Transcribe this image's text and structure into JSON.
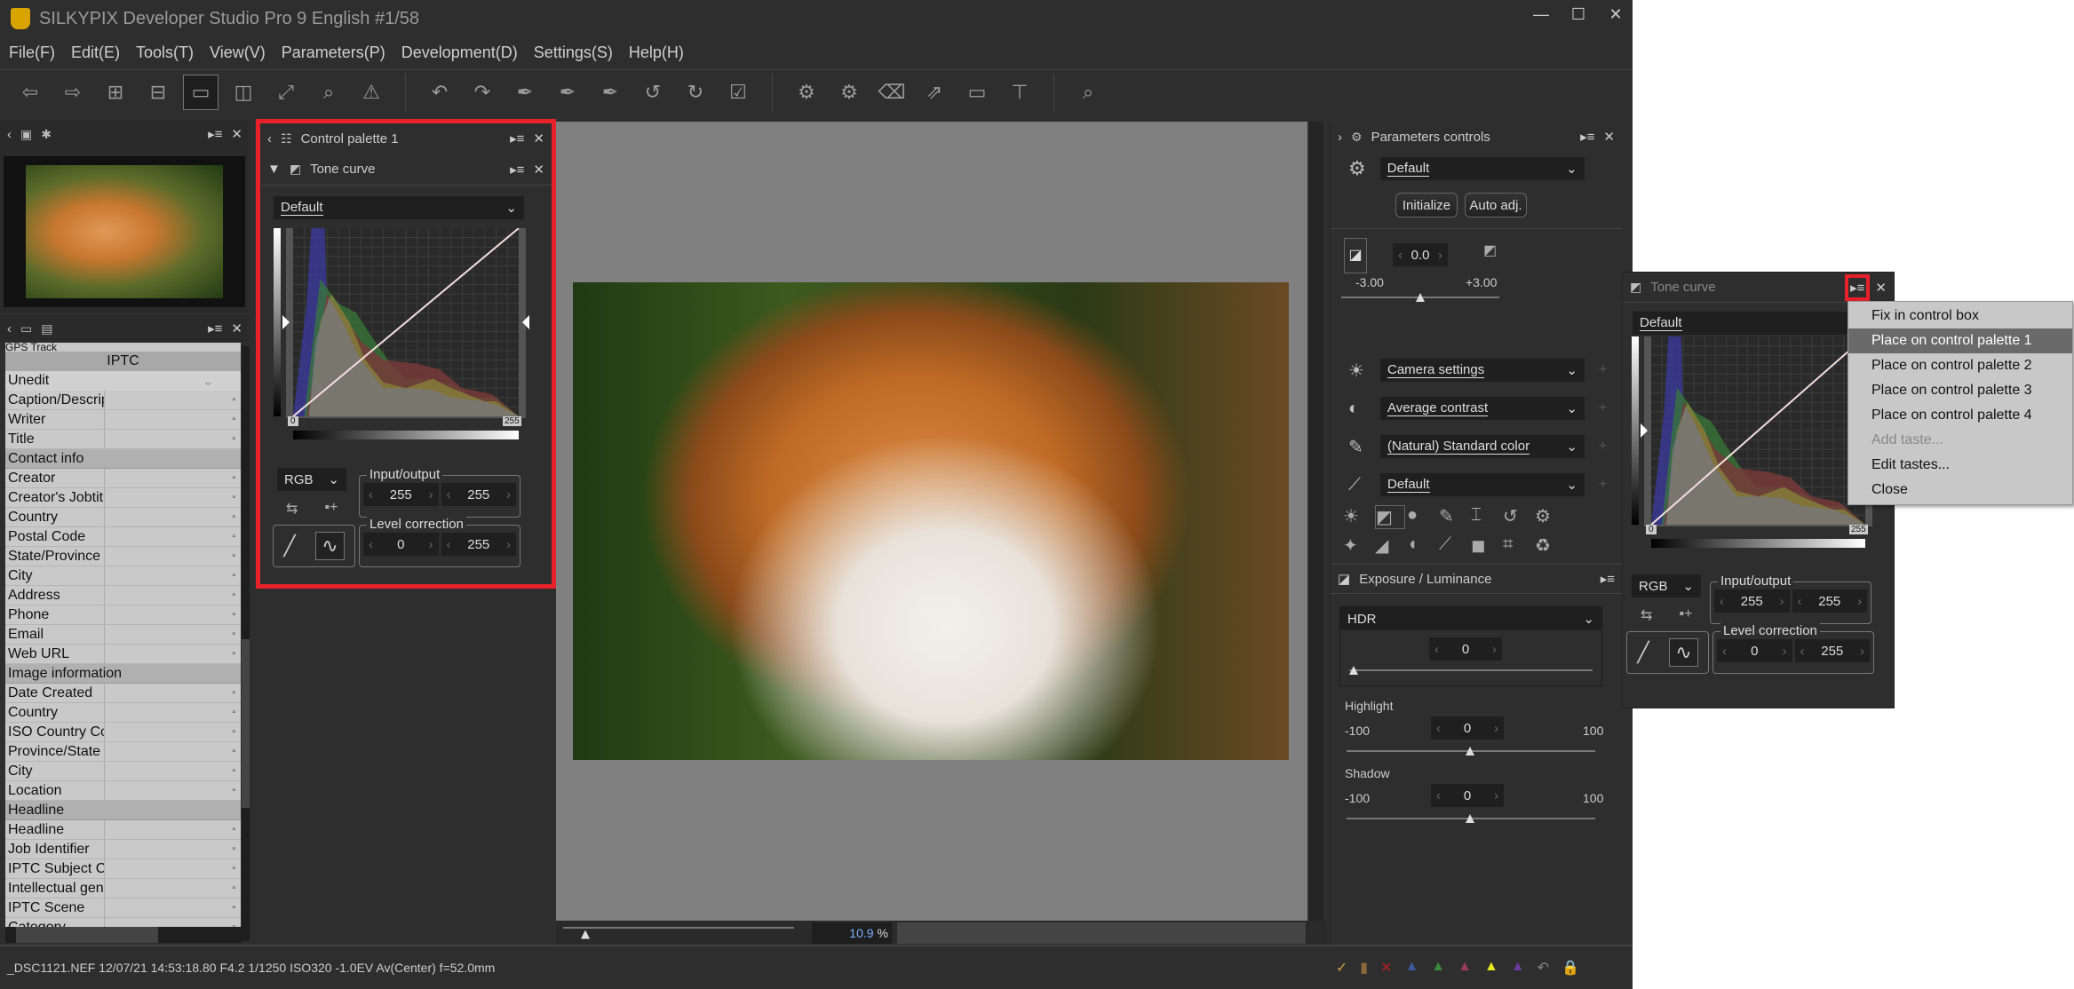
{
  "window": {
    "title": "SILKYPIX Developer Studio Pro 9 English   #1/58",
    "logo": "DS",
    "minimize": "—",
    "maximize": "☐",
    "close": "✕"
  },
  "menu": [
    "File(F)",
    "Edit(E)",
    "Tools(T)",
    "View(V)",
    "Parameters(P)",
    "Development(D)",
    "Settings(S)",
    "Help(H)"
  ],
  "toolbar_icons": [
    "prev-arrow",
    "next-arrow",
    "grid-view",
    "combined-view",
    "single-view",
    "compare-view",
    "fullscreen",
    "zoom",
    "warning",
    "undo",
    "redo",
    "pick-gray",
    "pick-gradation",
    "pick-black",
    "rotate-left",
    "rotate-right",
    "checkmark",
    "save-parameters",
    "apply-parameters",
    "eraser",
    "export",
    "display",
    "stamp",
    "search-thumbnails"
  ],
  "iptc": {
    "header": "IPTC",
    "preset": "Unedit",
    "cut_top": "GPS Track",
    "rows": [
      {
        "k": "Caption/Description"
      },
      {
        "k": "Writer"
      },
      {
        "k": "Title"
      },
      {
        "group": "Contact info"
      },
      {
        "k": "Creator"
      },
      {
        "k": "Creator's Jobtitle"
      },
      {
        "k": "Country"
      },
      {
        "k": "Postal Code"
      },
      {
        "k": "State/Province"
      },
      {
        "k": "City"
      },
      {
        "k": "Address"
      },
      {
        "k": "Phone"
      },
      {
        "k": "Email"
      },
      {
        "k": "Web URL"
      },
      {
        "group": "Image information"
      },
      {
        "k": "Date Created"
      },
      {
        "k": "Country"
      },
      {
        "k": "ISO Country Code"
      },
      {
        "k": "Province/State"
      },
      {
        "k": "City"
      },
      {
        "k": "Location"
      },
      {
        "group": "Headline"
      },
      {
        "k": "Headline"
      },
      {
        "k": "Job Identifier"
      },
      {
        "k": "IPTC Subject Code"
      },
      {
        "k": "Intellectual genre"
      },
      {
        "k": "IPTC Scene"
      },
      {
        "k": "Category"
      }
    ]
  },
  "palette": {
    "title": "Control palette 1",
    "section": "Tone curve",
    "preset": "Default",
    "channel": "RGB",
    "io_label": "Input/output",
    "io_in": "255",
    "io_out": "255",
    "level_label": "Level correction",
    "level_min": "0",
    "level_max": "255",
    "min_tag": "0",
    "max_tag": "255",
    "highlight_color": "#e8202a"
  },
  "viewer": {
    "zoom": "10.9",
    "zoom_unit": "%"
  },
  "params": {
    "title": "Parameters controls",
    "preset": "Default",
    "initialize": "Initialize",
    "auto": "Auto adj.",
    "exposure_value": "0.0",
    "exp_min": "-3.00",
    "exp_max": "+3.00",
    "wb": "Camera settings",
    "contrast": "Average contrast",
    "color": "(Natural) Standard color",
    "sharp": "Default"
  },
  "exposure": {
    "title": "Exposure / Luminance",
    "mode": "HDR",
    "hdr_value": "0",
    "highlight_label": "Highlight",
    "highlight_value": "0",
    "shadow_label": "Shadow",
    "shadow_value": "0",
    "min": "-100",
    "max": "100"
  },
  "floating": {
    "title": "Tone curve",
    "preset": "Default",
    "channel": "RGB",
    "io_label": "Input/output",
    "io_in": "255",
    "io_out": "255",
    "level_label": "Level correction",
    "level_min": "0",
    "level_max": "255",
    "min_tag": "0",
    "max_tag": "255"
  },
  "context_menu": {
    "items": [
      "Fix in control box",
      "Place on control palette 1",
      "Place on control palette 2",
      "Place on control palette 3",
      "Place on control palette 4",
      "Add taste...",
      "Edit tastes...",
      "Close"
    ],
    "highlighted": "Place on control palette 1",
    "disabled": "Add taste..."
  },
  "status": {
    "info": "_DSC1121.NEF 12/07/21 14:53:18.80 F4.2 1/1250 ISO320 -1.0EV Av(Center) f=52.0mm",
    "marks": [
      "✓",
      "▮",
      "✕",
      "▲",
      "▲",
      "▲",
      "▲",
      "▲",
      "↶",
      "🔒"
    ],
    "mark_colors": [
      "#c8a040",
      "#8a6a3a",
      "#b02020",
      "#3a5a9a",
      "#3a8a3a",
      "#9a3a5a",
      "#e8e820",
      "#6a3a9a",
      "#888",
      "#888"
    ]
  }
}
